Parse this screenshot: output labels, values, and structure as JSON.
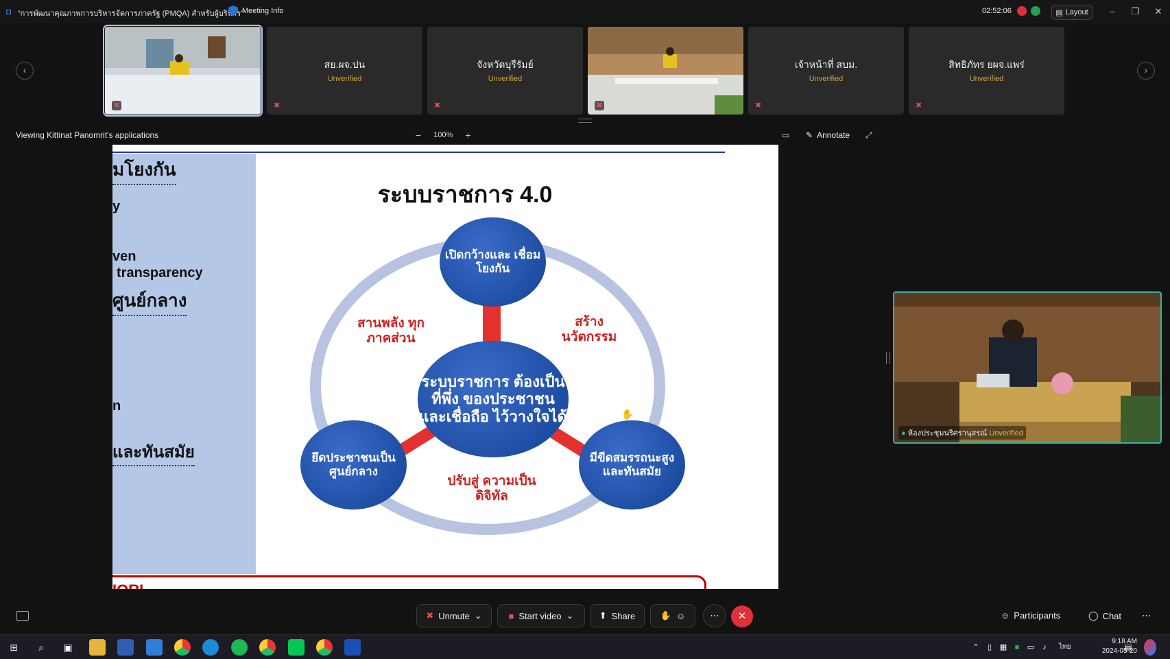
{
  "window": {
    "title": "“การพัฒนาคุณภาพการบริหารจัดการภาครัฐ (PMQA) สำหรับผู้บริหาร”",
    "meeting_info": "Meeting Info",
    "timer": "02:52:06",
    "layout_label": "Layout"
  },
  "participants": [
    {
      "name": "",
      "status": ""
    },
    {
      "name": "สย.ผจ.ปน",
      "status": "Unverified"
    },
    {
      "name": "จังหวัดบุรีรัมย์",
      "status": "Unverified"
    },
    {
      "name": "",
      "status": ""
    },
    {
      "name": "เจ้าหน้าที่ สบม.",
      "status": "Unverified"
    },
    {
      "name": "สิทธิภัทร ยผจ.แพร่",
      "status": "Unverified"
    }
  ],
  "share_bar": {
    "viewing": "Viewing Kittinat Panomrit's applications",
    "zoom": "100%",
    "annotate": "Annotate"
  },
  "slide": {
    "fragments": [
      "มโยงกัน",
      "y",
      "ven",
      "transparency",
      "ศูนย์กลาง",
      "n",
      "และทันสมัย",
      "IORI"
    ],
    "title": "ระบบราชการ 4.0",
    "center": "ระบบราชการ ต้องเป็นที่พึ่ง ของประชาชน และเชื่อถือ ไว้วางใจได้",
    "top": "เปิดกว้างและ เชื่อมโยงกัน",
    "left": "ยึดประชาชนเป็น ศูนย์กลาง",
    "right": "มีขีดสมรรถนะสูง และทันสมัย",
    "arc_left": "สานพลัง ทุกภาคส่วน",
    "arc_right": "สร้าง นวัตกรรม",
    "arc_bottom": "ปรับสู่ ความเป็นดิจิทัล"
  },
  "self_view": {
    "label": "ห้องประชุมนริศรานุสรณ์",
    "status": "Unverified"
  },
  "controls": {
    "unmute": "Unmute",
    "start_video": "Start video",
    "share": "Share",
    "participants": "Participants",
    "chat": "Chat"
  },
  "taskbar": {
    "time": "9:18 AM",
    "date": "2024-05-20",
    "lang": "ไทย"
  },
  "colors": {
    "accent": "#37b39a",
    "unverified": "#d4a23a",
    "end_call": "#e0313a",
    "slide_blue": "#1f4fa4",
    "slide_red": "#d12020"
  }
}
